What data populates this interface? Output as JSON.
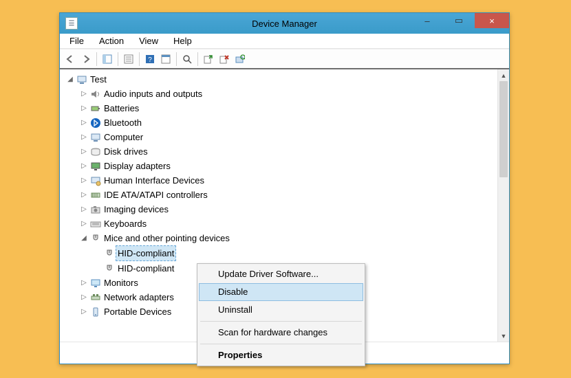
{
  "window": {
    "title": "Device Manager",
    "controls": {
      "min": "–",
      "max": "▭",
      "close": "×"
    }
  },
  "menu": {
    "items": [
      "File",
      "Action",
      "View",
      "Help"
    ]
  },
  "toolbar": {
    "back": "back-icon",
    "forward": "forward-icon",
    "showhide": "showhide-icon",
    "properties": "properties-icon",
    "help": "help-icon",
    "details": "details-icon",
    "search": "search-icon",
    "update": "update-driver-icon",
    "uninstall": "uninstall-icon",
    "scan": "scan-hw-icon"
  },
  "tree": {
    "root": {
      "label": "Test",
      "expanded": true
    },
    "items": [
      {
        "label": "Audio inputs and outputs",
        "icon": "audio-icon"
      },
      {
        "label": "Batteries",
        "icon": "battery-icon"
      },
      {
        "label": "Bluetooth",
        "icon": "bluetooth-icon"
      },
      {
        "label": "Computer",
        "icon": "computer-icon"
      },
      {
        "label": "Disk drives",
        "icon": "disk-icon"
      },
      {
        "label": "Display adapters",
        "icon": "display-icon"
      },
      {
        "label": "Human Interface Devices",
        "icon": "hid-icon"
      },
      {
        "label": "IDE ATA/ATAPI controllers",
        "icon": "ide-icon"
      },
      {
        "label": "Imaging devices",
        "icon": "imaging-icon"
      },
      {
        "label": "Keyboards",
        "icon": "keyboard-icon"
      },
      {
        "label": "Mice and other pointing devices",
        "icon": "mouse-icon",
        "expanded": true,
        "children": [
          {
            "label": "HID-compliant",
            "icon": "mouse-icon",
            "selected": true
          },
          {
            "label": "HID-compliant",
            "icon": "mouse-icon"
          }
        ]
      },
      {
        "label": "Monitors",
        "icon": "monitor-icon"
      },
      {
        "label": "Network adapters",
        "icon": "network-icon"
      },
      {
        "label": "Portable Devices",
        "icon": "portable-icon"
      }
    ]
  },
  "context_menu": {
    "items": [
      {
        "label": "Update Driver Software...",
        "type": "item"
      },
      {
        "label": "Disable",
        "type": "item",
        "hover": true
      },
      {
        "label": "Uninstall",
        "type": "item"
      },
      {
        "type": "sep"
      },
      {
        "label": "Scan for hardware changes",
        "type": "item"
      },
      {
        "type": "sep"
      },
      {
        "label": "Properties",
        "type": "item",
        "bold": true
      }
    ]
  }
}
